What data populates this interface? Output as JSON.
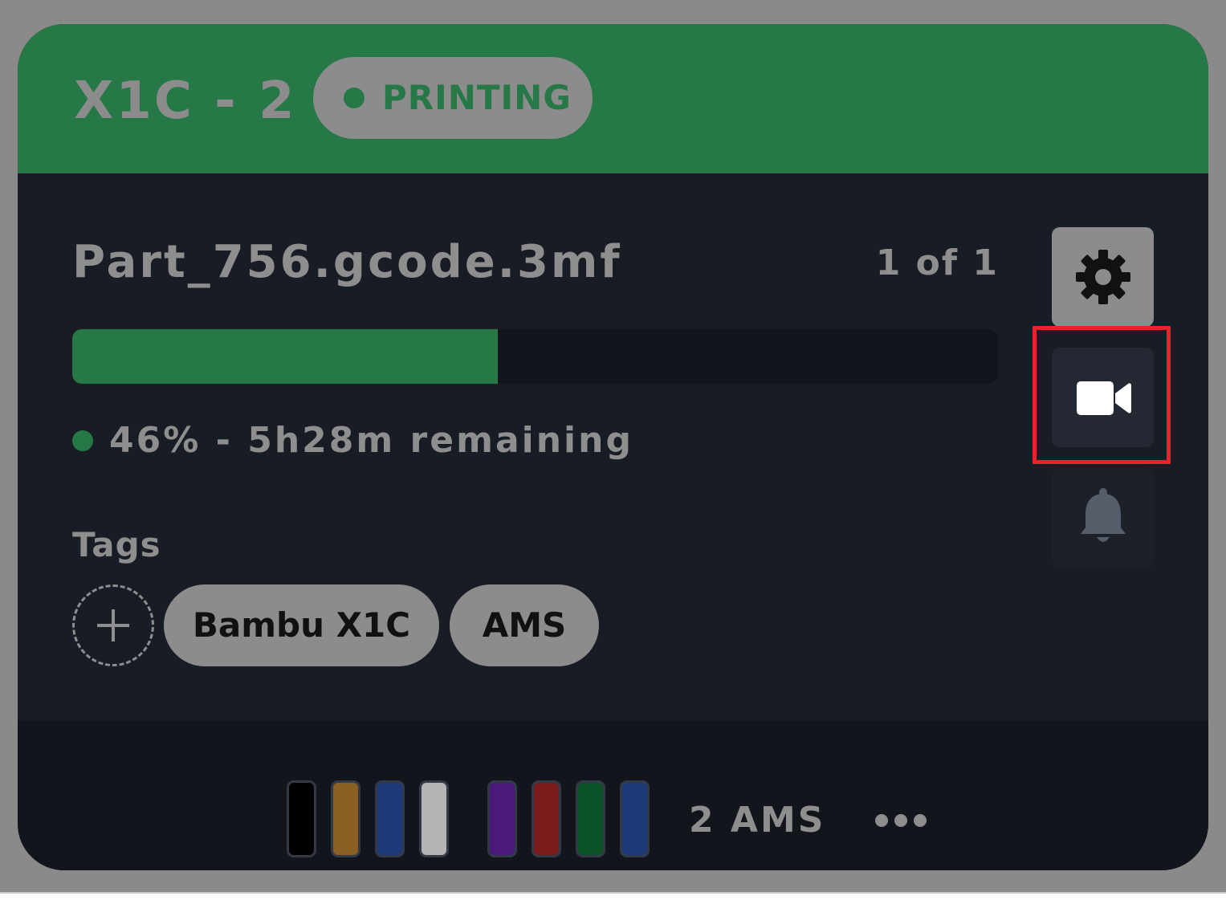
{
  "printer": {
    "name": "X1C - 2",
    "status": "PRINTING"
  },
  "job": {
    "file_name": "Part_756.gcode.3mf",
    "count": "1 of 1",
    "progress_fraction": 0.46,
    "progress_text": "46% - 5h28m remaining"
  },
  "tags": {
    "label": "Tags",
    "items": [
      "Bambu X1C",
      "AMS"
    ]
  },
  "actions": {
    "settings_icon": "gear-icon",
    "camera_icon": "video-camera-icon",
    "notifications_icon": "bell-icon"
  },
  "ams": {
    "units": [
      [
        "#000000",
        "#8a6024",
        "#1e3a78",
        "#b4b4b4"
      ],
      [
        "#4a1a7a",
        "#7a1c1c",
        "#0c5428",
        "#1e3a78"
      ]
    ],
    "label": "2 AMS"
  },
  "colors": {
    "header_green": "#267846",
    "card_bg": "#181c24",
    "overlay_gray": "#8a8a8a",
    "highlight_red": "#e8232b"
  }
}
